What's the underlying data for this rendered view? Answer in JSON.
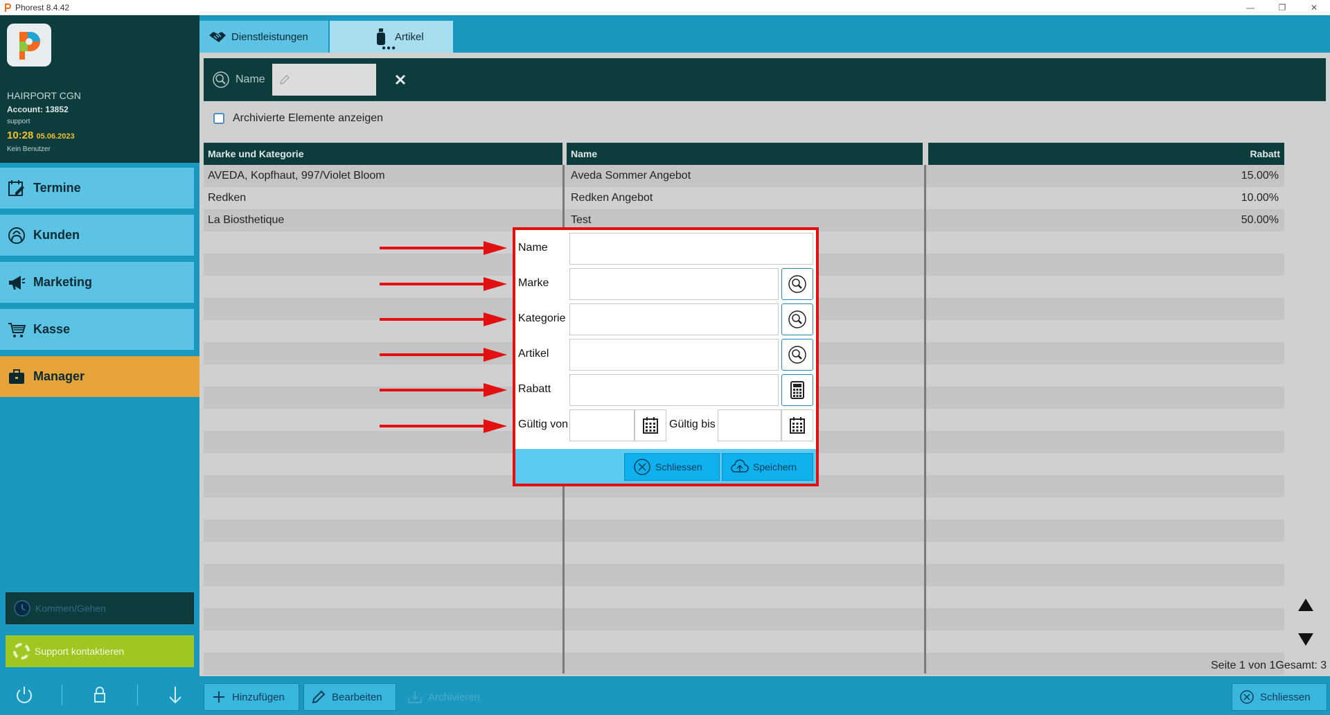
{
  "window": {
    "title": "Phorest 8.4.42"
  },
  "sidebar": {
    "salon_name": "HAIRPORT CGN",
    "account": "Account: 13852",
    "support_user": "support",
    "time": "10:28",
    "date": "05.06.2023",
    "user_status": "Kein Benutzer",
    "nav": [
      {
        "label": "Termine",
        "icon": "calendar-edit-icon"
      },
      {
        "label": "Kunden",
        "icon": "client-icon"
      },
      {
        "label": "Marketing",
        "icon": "megaphone-icon"
      },
      {
        "label": "Kasse",
        "icon": "cart-icon"
      },
      {
        "label": "Manager",
        "icon": "briefcase-icon"
      }
    ],
    "kommen_gehen": "Kommen/Gehen",
    "support_contact": "Support kontaktieren"
  },
  "tabs": [
    {
      "label": "Dienstleistungen"
    },
    {
      "label": "Artikel"
    }
  ],
  "search": {
    "label": "Name"
  },
  "archive_toggle": "Archivierte Elemente anzeigen",
  "table": {
    "headers": [
      "Marke und Kategorie",
      "Name",
      "Rabatt"
    ],
    "rows": [
      [
        "AVEDA, Kopfhaut, 997/Violet Bloom",
        "Aveda Sommer Angebot",
        "15.00%"
      ],
      [
        "Redken",
        "Redken Angebot",
        "10.00%"
      ],
      [
        "La Biosthetique",
        "Test",
        "50.00%"
      ]
    ]
  },
  "pager": "Seite 1 von 1Gesamt: 3",
  "bottom_bar": {
    "add": "Hinzufügen",
    "edit": "Bearbeiten",
    "archive": "Archivieren",
    "close": "Schliessen"
  },
  "modal": {
    "name_label": "Name",
    "brand_label": "Marke",
    "category_label": "Kategorie",
    "article_label": "Artikel",
    "discount_label": "Rabatt",
    "valid_from_label": "Gültig von",
    "valid_to_label": "Gültig bis",
    "close_label": "Schliessen",
    "save_label": "Speichern"
  },
  "colors": {
    "sidebar_dark": "#0d3c3d",
    "accent_blue": "#1a98c0",
    "nav_active": "#e6a43a",
    "highlight_red": "#e21010"
  }
}
